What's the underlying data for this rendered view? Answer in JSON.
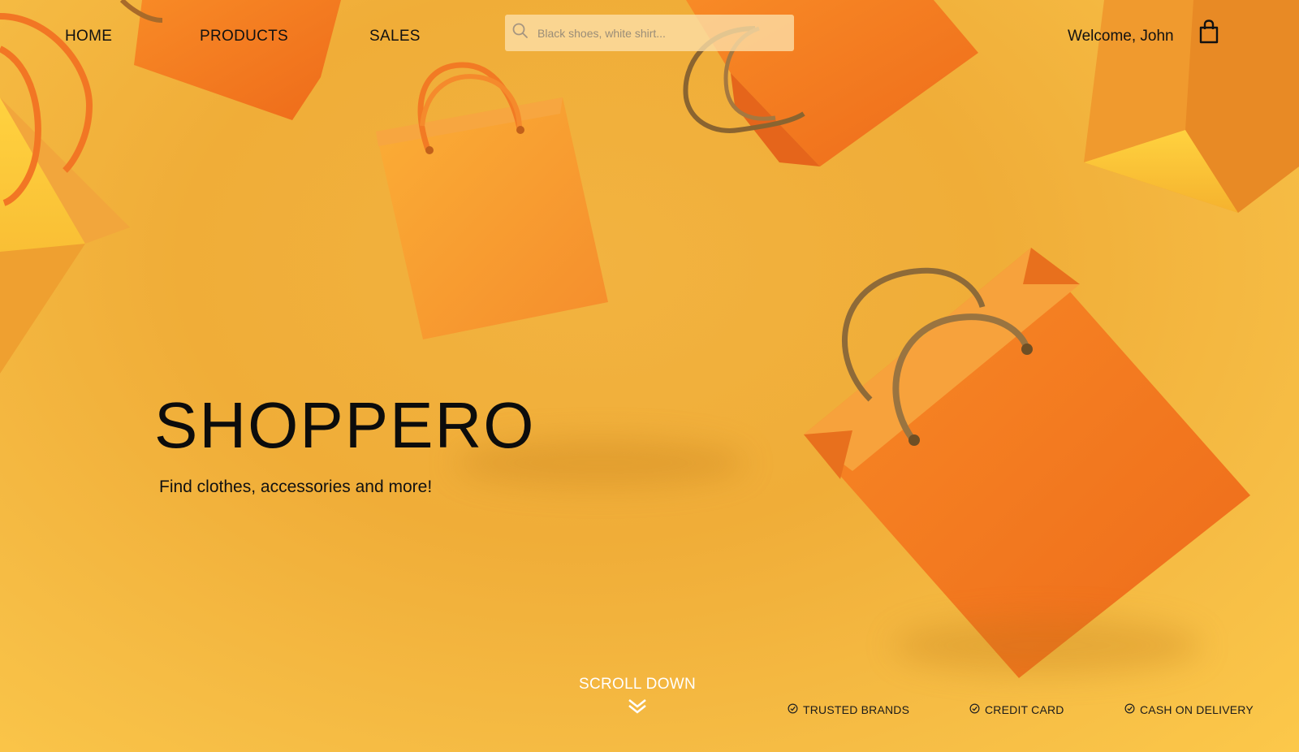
{
  "nav": {
    "items": [
      {
        "label": "HOME"
      },
      {
        "label": "PRODUCTS"
      },
      {
        "label": "SALES"
      }
    ],
    "search_placeholder": "Black shoes, white shirt...",
    "welcome": "Welcome, John"
  },
  "hero": {
    "title": "SHOPPERO",
    "tagline": "Find clothes, accessories and more!"
  },
  "scroll": {
    "label": "SCROLL DOWN"
  },
  "features": [
    {
      "label": "TRUSTED BRANDS"
    },
    {
      "label": "CREDIT CARD"
    },
    {
      "label": "CASH ON DELIVERY"
    }
  ],
  "colors": {
    "background": "#f2b340",
    "bag_orange": "#f47a20",
    "bag_light": "#faa334"
  },
  "icons": [
    "search-icon",
    "shopping-bag-icon",
    "double-chevron-down-icon",
    "check-circle-icon"
  ]
}
